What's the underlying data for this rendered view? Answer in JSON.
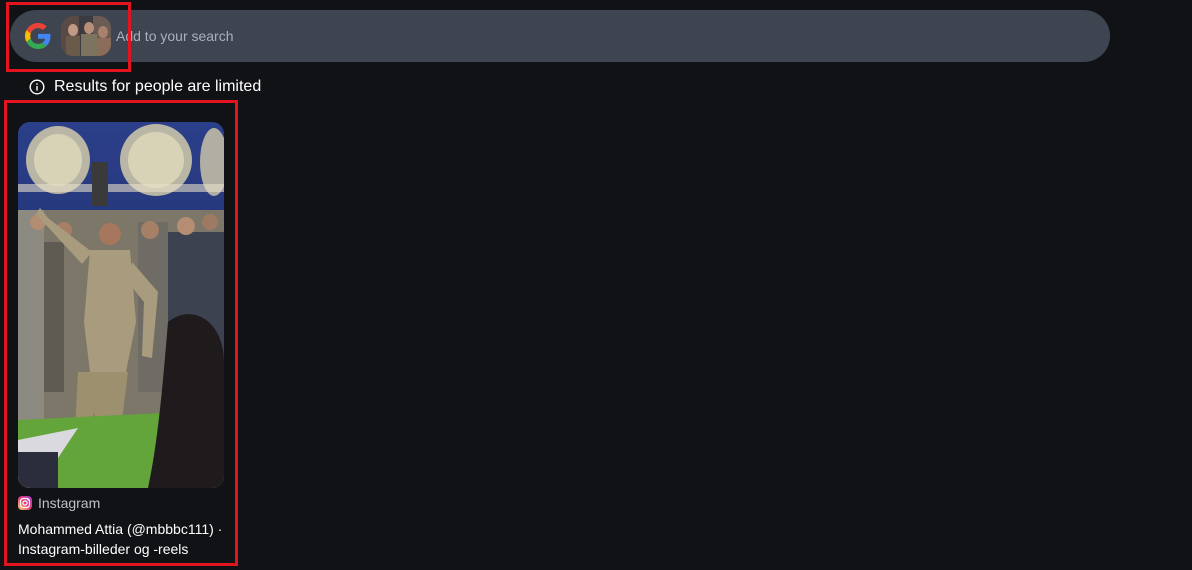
{
  "search": {
    "placeholder": "Add to your search"
  },
  "icons": {
    "google_logo": "google-g-logo",
    "info": "info-icon",
    "instagram": "instagram-icon"
  },
  "notice": {
    "text": "Results for people are limited"
  },
  "results": [
    {
      "source": "Instagram",
      "title": "Mohammed Attia (@mbbbc111) · Instagram-billeder og -reels"
    }
  ],
  "colors": {
    "background": "#111216",
    "search_bar": "#3f4451",
    "highlight": "#e3141f",
    "text_primary": "#ffffff",
    "text_secondary": "#bdc1c6"
  }
}
